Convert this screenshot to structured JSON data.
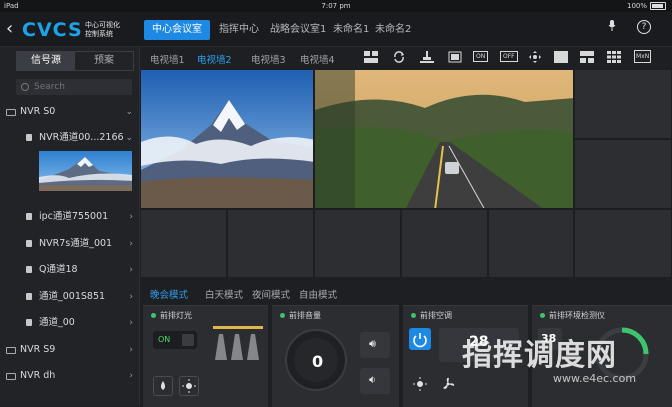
{
  "statusbar": {
    "device": "iPad",
    "time": "7:07 pm",
    "battery": "100%"
  },
  "topbar": {
    "logo": "CVCS",
    "logo_sub_1": "中心可视化",
    "logo_sub_2": "控制系统",
    "tabs": [
      {
        "label": "中心会议室",
        "active": true
      },
      {
        "label": "指挥中心"
      },
      {
        "label": "战略会议室1"
      },
      {
        "label": "未命名1"
      },
      {
        "label": "未命名2"
      }
    ]
  },
  "sidebar": {
    "tabs": [
      {
        "label": "信号源",
        "active": true
      },
      {
        "label": "预案"
      }
    ],
    "search_placeholder": "Search",
    "items": [
      {
        "label": "NVR S0"
      },
      {
        "label": "NVR通道00...2166"
      },
      {
        "label": "ipc通道755001"
      },
      {
        "label": "NVR7s通道_001"
      },
      {
        "label": "Q通道18"
      },
      {
        "label": "通道_001S851"
      },
      {
        "label": "通道_00"
      },
      {
        "label": "NVR S9"
      },
      {
        "label": "NVR dh"
      }
    ]
  },
  "wall_tabs": [
    {
      "label": "电视墙1"
    },
    {
      "label": "电视墙2",
      "active": true
    },
    {
      "label": "电视墙3"
    },
    {
      "label": "电视墙4"
    }
  ],
  "toolbar": {
    "on_label": "ON",
    "off_label": "OFF",
    "mxn_label": "MxN"
  },
  "modes": [
    {
      "label": "晚会模式",
      "active": true
    },
    {
      "label": "白天模式"
    },
    {
      "label": "夜间模式"
    },
    {
      "label": "自由模式"
    }
  ],
  "panels": {
    "light": {
      "title": "前排灯光",
      "toggle": "ON"
    },
    "volume": {
      "title": "前排音量",
      "value": "0"
    },
    "ac": {
      "title": "前排空调",
      "temp": "28"
    },
    "env": {
      "title": "前排环境检测仪",
      "value": "38"
    }
  },
  "watermark": {
    "main": "指挥调度网",
    "sub": "www.e4ec.com"
  }
}
